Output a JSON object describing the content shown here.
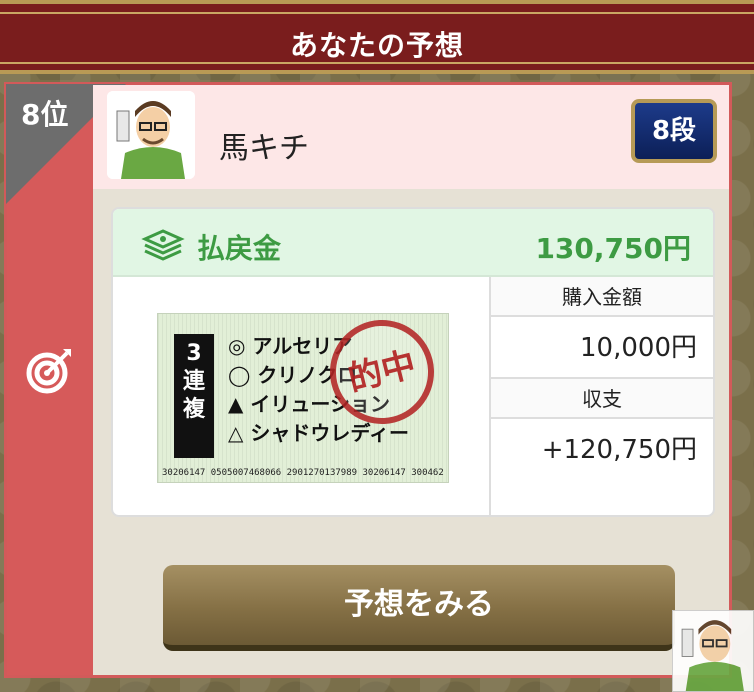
{
  "header": {
    "title": "あなたの予想"
  },
  "rank": {
    "label": "8位"
  },
  "user": {
    "name": "馬キチ",
    "dan": "8段"
  },
  "payout": {
    "label": "払戻金",
    "value": "130,750円"
  },
  "ticket": {
    "bet_type": "3連複",
    "picks": [
      "◎ アルセリア",
      "◯ クリノクロ",
      "▲ イリューション",
      "△ シャドウレディー"
    ],
    "barcode": "30206147   0505007468066 2901270137989 30206147 300462",
    "stamp": "的中"
  },
  "stats": {
    "purchase_label": "購入金額",
    "purchase_value": "10,000円",
    "balance_label": "収支",
    "balance_value": "+120,750円"
  },
  "actions": {
    "view_label": "予想をみる"
  },
  "colors": {
    "accent_red": "#d65a5a",
    "header_red": "#7a1d1d",
    "payout_green": "#3d9b43",
    "button_gold": "#857045"
  }
}
